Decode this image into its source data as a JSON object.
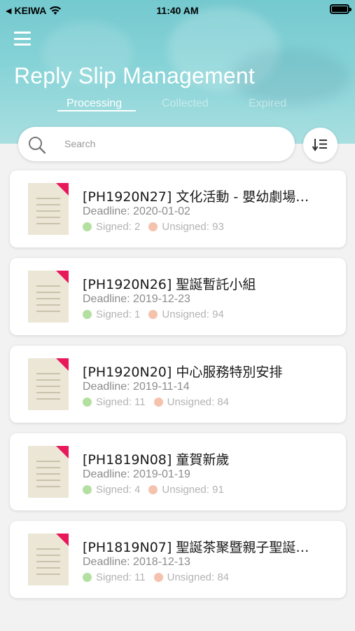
{
  "status_bar": {
    "carrier": "KEIWA",
    "time": "11:40 AM"
  },
  "header": {
    "title": "Reply Slip Management",
    "tabs": [
      {
        "label": "Processing",
        "active": true
      },
      {
        "label": "Collected",
        "active": false
      },
      {
        "label": "Expired",
        "active": false
      }
    ]
  },
  "search": {
    "placeholder": "Search"
  },
  "colors": {
    "header": "#7ccbd0",
    "signed_dot": "#b3e0a0",
    "unsigned_dot": "#f5c2ae",
    "doc_corner": "#e8195a"
  },
  "slips": [
    {
      "title": "[PH1920N27] 文化活動 - 嬰幼劇場…",
      "deadline": "Deadline: 2020-01-02",
      "signed": "Signed: 2",
      "unsigned": "Unsigned: 93"
    },
    {
      "title": "[PH1920N26] 聖誕暫託小組",
      "deadline": "Deadline: 2019-12-23",
      "signed": "Signed: 1",
      "unsigned": "Unsigned: 94"
    },
    {
      "title": "[PH1920N20] 中心服務特別安排",
      "deadline": "Deadline: 2019-11-14",
      "signed": "Signed: 11",
      "unsigned": "Unsigned: 84"
    },
    {
      "title": "[PH1819N08] 童賀新歲",
      "deadline": "Deadline: 2019-01-19",
      "signed": "Signed: 4",
      "unsigned": "Unsigned: 91"
    },
    {
      "title": "[PH1819N07] 聖誕茶聚暨親子聖誕…",
      "deadline": "Deadline: 2018-12-13",
      "signed": "Signed: 11",
      "unsigned": "Unsigned: 84"
    }
  ]
}
